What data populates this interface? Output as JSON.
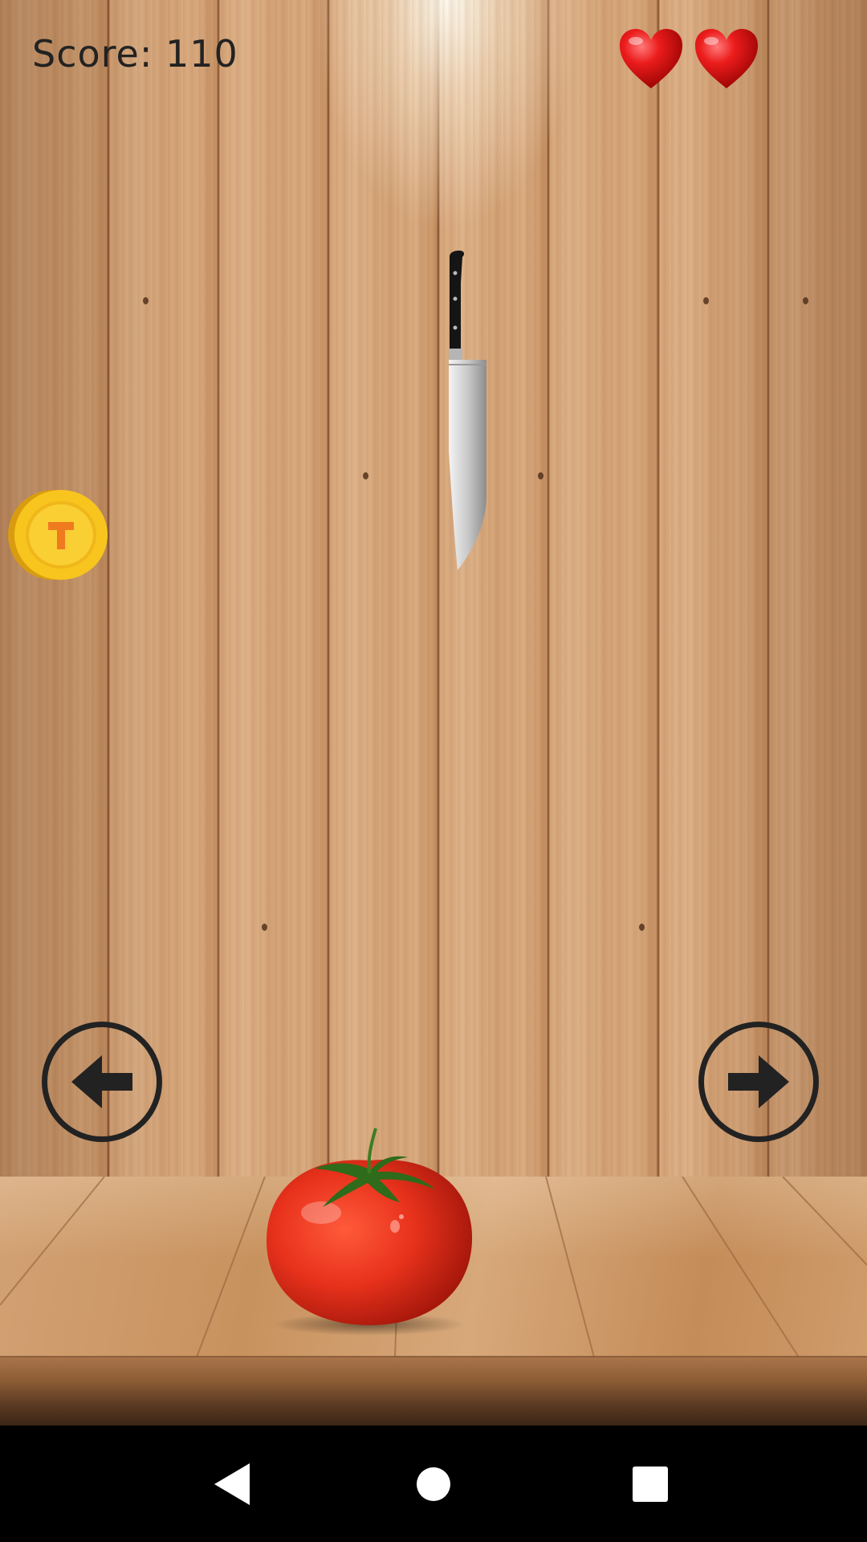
{
  "hud": {
    "score_label": "Score: 110",
    "score": 110,
    "lives": 2,
    "heart_color": "#e0151b"
  },
  "game_objects": {
    "falling_item": "knife-icon",
    "bonus_item": "coin-icon",
    "player": "tomato-icon"
  },
  "controls": {
    "left_button": "arrow-left-icon",
    "right_button": "arrow-right-icon"
  },
  "navbar": {
    "back": "back-icon",
    "home": "home-icon",
    "recents": "recents-icon"
  },
  "colors": {
    "coin_gold": "#f7c51e",
    "coin_symbol": "#f07a20",
    "tomato_red": "#e8321c",
    "control_stroke": "#222222"
  }
}
